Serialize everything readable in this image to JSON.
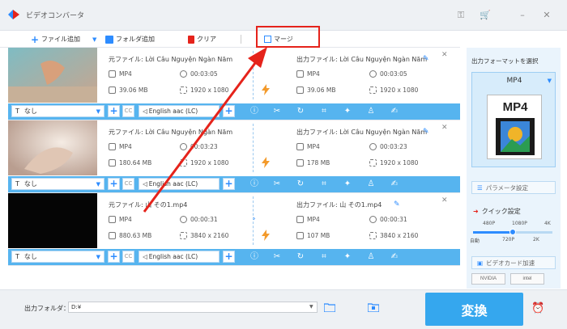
{
  "window": {
    "title": "ビデオコンバータ",
    "controls": [
      "key-icon",
      "cart-icon",
      "minimize-icon",
      "close-icon"
    ]
  },
  "toolbar": {
    "add_file": "ファイル追加",
    "add_folder": "フォルダ追加",
    "clear": "クリア",
    "merge": "マージ"
  },
  "items": [
    {
      "src_title": "元ファイル: Lời Câu Nguyện Ngàn Năm",
      "dst_title": "出力ファイル: Lời Câu Nguyện Ngàn Năm",
      "src_format": "MP4",
      "src_duration": "00:03:05",
      "src_size": "39.06 MB",
      "src_resolution": "1920 x 1080",
      "dst_format": "MP4",
      "dst_duration": "00:03:05",
      "dst_size": "39.06 MB",
      "dst_resolution": "1920 x 1080",
      "subtitle": "なし",
      "audio": "English aac (LC)"
    },
    {
      "src_title": "元ファイル: Lời Câu Nguyện Ngàn Năm",
      "dst_title": "出力ファイル: Lời Câu Nguyện Ngàn Năm",
      "src_format": "MP4",
      "src_duration": "00:03:23",
      "src_size": "180.64 MB",
      "src_resolution": "1920 x 1080",
      "dst_format": "MP4",
      "dst_duration": "00:03:23",
      "dst_size": "178 MB",
      "dst_resolution": "1920 x 1080",
      "subtitle": "なし",
      "audio": "English aac (LC)"
    },
    {
      "src_title": "元ファイル: 山 その1.mp4",
      "dst_title": "出力ファイル: 山 その1.mp4",
      "src_format": "MP4",
      "src_duration": "00:00:31",
      "src_size": "880.63 MB",
      "src_resolution": "3840 x 2160",
      "dst_format": "MP4",
      "dst_duration": "00:00:31",
      "dst_size": "107 MB",
      "dst_resolution": "3840 x 2160",
      "subtitle": "なし",
      "audio": "English aac (LC)"
    }
  ],
  "right_panel": {
    "title": "出力フォーマットを選択",
    "format": "MP4",
    "format_icon_label": "MP4",
    "params": "パラメータ設定",
    "quick": "クイック設定",
    "slider_top": [
      "480P",
      "1080P",
      "4K"
    ],
    "slider_bottom": [
      "自動",
      "720P",
      "2K"
    ],
    "slider_level": 0.5,
    "gpu": "ビデオカード加速",
    "gpu_badges": [
      "NVIDIA",
      "intel"
    ]
  },
  "footer": {
    "out_label": "出力フォルダ：",
    "out_path": "D:¥",
    "convert": "変換"
  },
  "colors": {
    "accent": "#35a7ee",
    "bar": "#56b4ef",
    "highlight": "#e5231b",
    "bolt": "#f39a2b"
  }
}
